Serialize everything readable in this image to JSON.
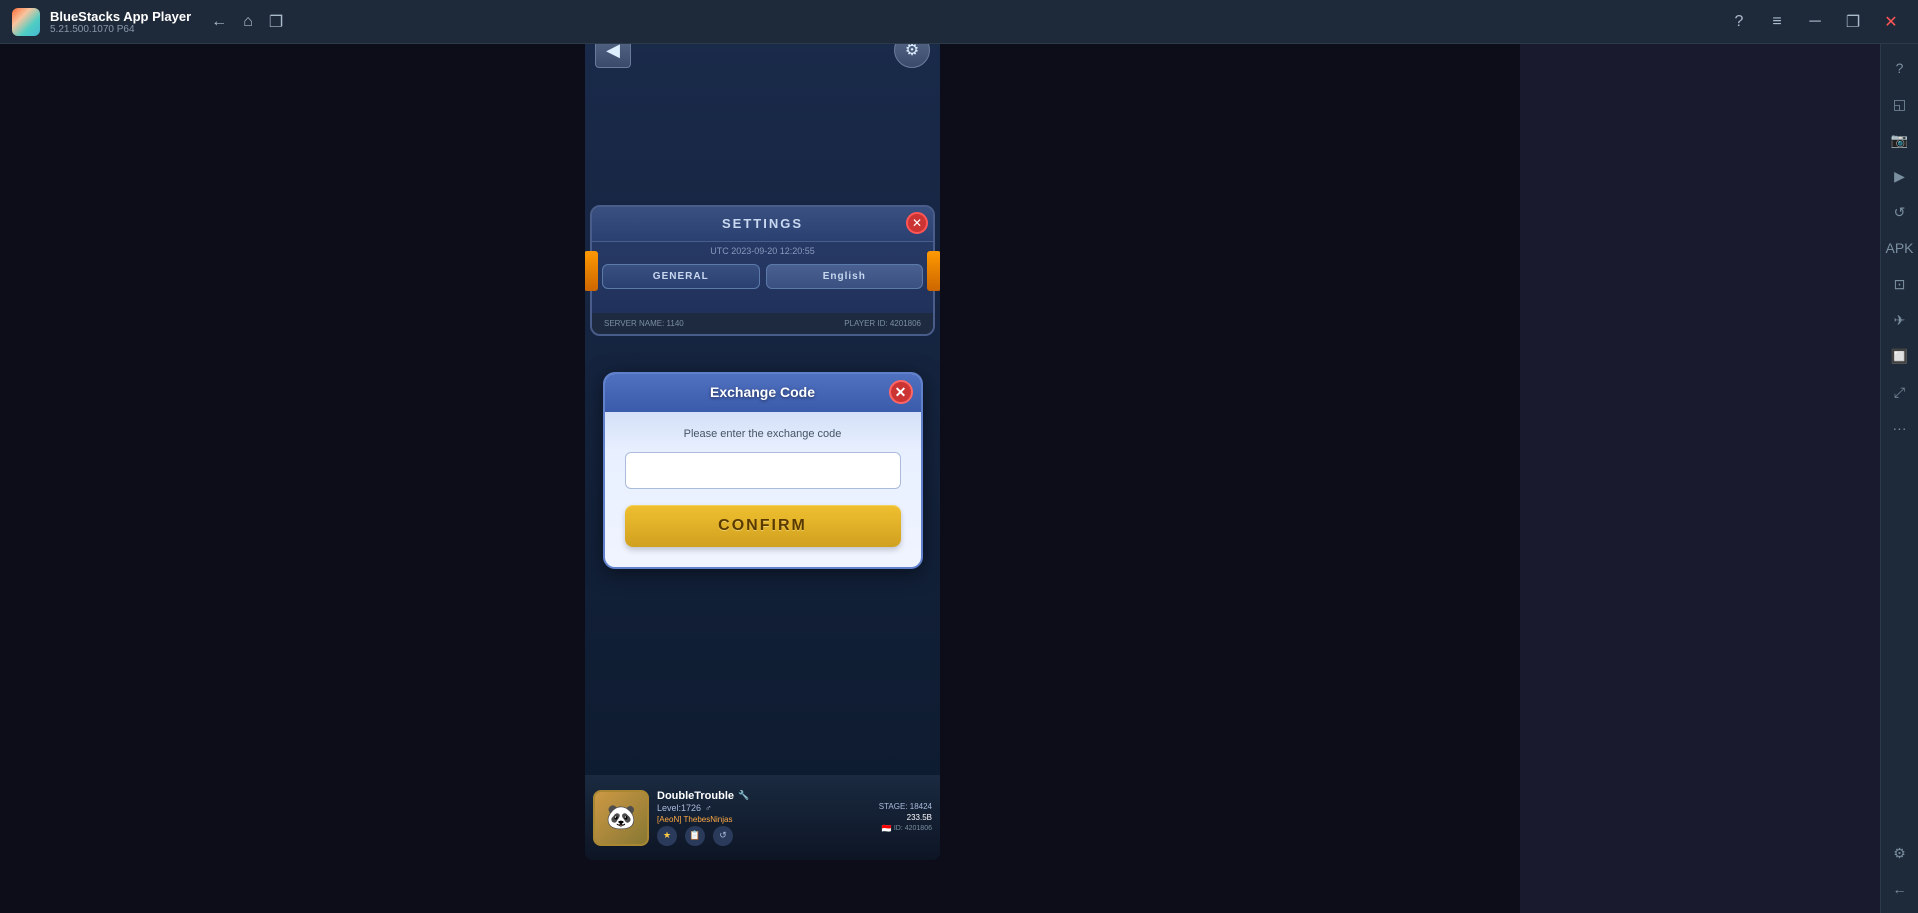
{
  "titlebar": {
    "app_name": "BlueStacks App Player",
    "version": "5.21.500.1070  P64",
    "back_icon": "←",
    "home_icon": "⌂",
    "copy_icon": "❐",
    "help_icon": "?",
    "menu_icon": "≡",
    "minimize_icon": "─",
    "restore_icon": "❐",
    "close_icon": "✕"
  },
  "sidebar": {
    "icons": [
      "?",
      "≡",
      "─",
      "❐",
      "✕",
      "📷",
      "🎬",
      "↺",
      "📦",
      "📷",
      "⊡",
      "🛫",
      "📷",
      "↺",
      "···",
      "⚙",
      "←"
    ]
  },
  "game": {
    "settings_panel": {
      "title": "SETTINGS",
      "close_icon": "✕",
      "datetime": "UTC 2023-09-20 12:20:55",
      "tabs": [
        {
          "label": "GENERAL",
          "active": false
        },
        {
          "label": "English",
          "active": true
        }
      ],
      "close_btn_icon": "✕"
    },
    "exchange_dialog": {
      "title": "Exchange Code",
      "close_icon": "✕",
      "instruction": "Please enter the exchange code",
      "input_placeholder": "",
      "confirm_label": "CONFIRM"
    },
    "footer": {
      "server_label": "SERVER NAME: 1140",
      "player_label": "PLAYER ID: 4201806"
    }
  },
  "player": {
    "name": "DoubleTrouble",
    "name_icon": "🔧",
    "level": "Level:1726",
    "gender_icon": "♂",
    "guild": "[AeoN] ThebesNinjas",
    "id_label": "ID: 4201806",
    "stage_label": "STAGE: 18424",
    "power": "233.5B",
    "flag": "🇮🇩"
  }
}
